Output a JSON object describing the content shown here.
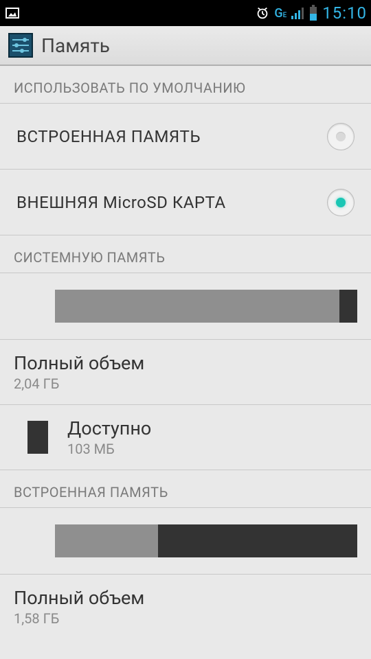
{
  "status": {
    "time": "15:10",
    "network_label": "G",
    "network_sub": "E"
  },
  "header": {
    "title": "Память"
  },
  "sections": {
    "default_use": {
      "header": "ИСПОЛЬЗОВАТЬ ПО УМОЛЧАНИЮ",
      "options": [
        {
          "label": "ВСТРОЕННАЯ ПАМЯТЬ",
          "selected": false
        },
        {
          "label": "ВНЕШНЯЯ MicroSD КАРТА",
          "selected": true
        }
      ]
    },
    "system_memory": {
      "header": "СИСТЕМНУЮ ПАМЯТЬ",
      "bar": {
        "segments": [
          {
            "color": "#8f8f8f",
            "start_pct": 0,
            "width_pct": 94
          },
          {
            "color": "#333333",
            "start_pct": 94,
            "width_pct": 6
          }
        ]
      },
      "total": {
        "label": "Полный объем",
        "value": "2,04 ГБ"
      },
      "available": {
        "label": "Доступно",
        "value": "103 МБ",
        "swatch": "#333333"
      }
    },
    "internal_memory": {
      "header": "ВСТРОЕННАЯ ПАМЯТЬ",
      "bar": {
        "segments": [
          {
            "color": "#8f8f8f",
            "start_pct": 0,
            "width_pct": 34
          },
          {
            "color": "#333333",
            "start_pct": 34,
            "width_pct": 66
          }
        ]
      },
      "total": {
        "label": "Полный объем",
        "value": "1,58 ГБ"
      }
    }
  }
}
